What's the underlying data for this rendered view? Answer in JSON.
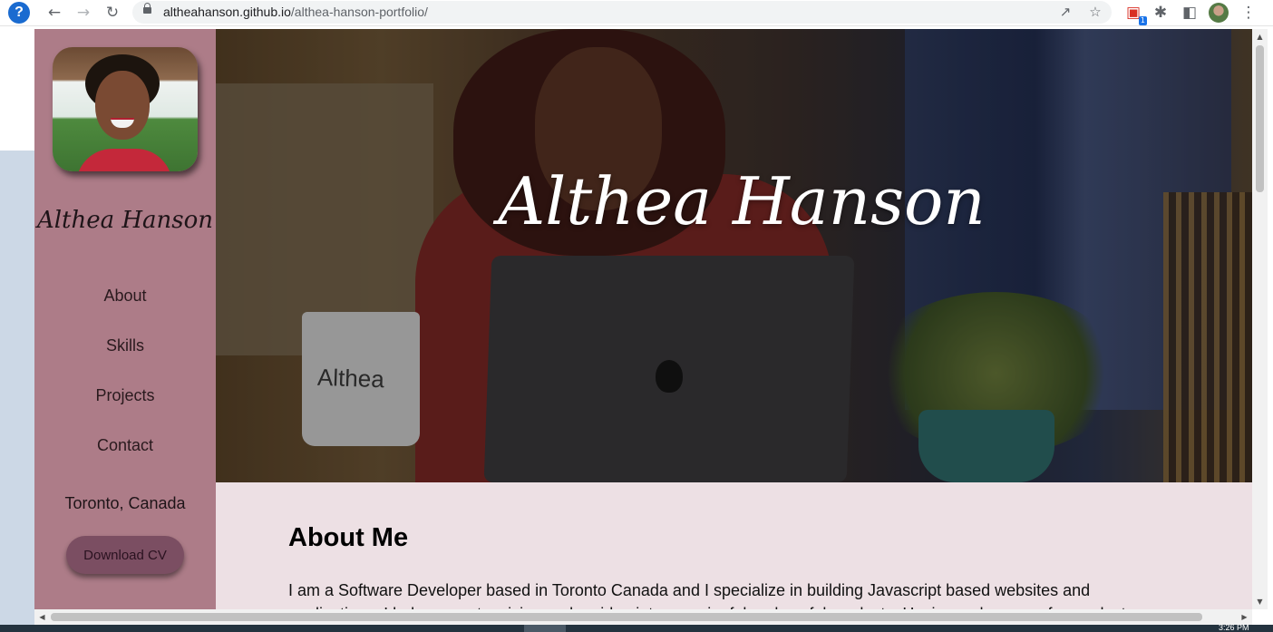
{
  "browser": {
    "url_host": "altheahanson.github.io",
    "url_path": "/althea-hanson-portfolio/",
    "extension_badge": "1"
  },
  "sidebar": {
    "name": "Althea Hanson",
    "nav": [
      "About",
      "Skills",
      "Projects",
      "Contact"
    ],
    "location": "Toronto, Canada",
    "download_cv": "Download CV"
  },
  "hero": {
    "title": "Althea Hanson",
    "mug_text": "Althea"
  },
  "about": {
    "heading": "About Me",
    "text": "I am a Software Developer based in Toronto Canada and I specialize in building Javascript based websites and applications. I help convert a vision and an idea into meaningful and useful products. Having a sharp eye for product"
  },
  "taskbar": {
    "clock": "3:26 PM"
  },
  "colors": {
    "sidebar": "#ad7c88",
    "about_bg": "#ede0e4",
    "cv_button": "#7b4e62",
    "page_left": "#ccd8e6"
  }
}
